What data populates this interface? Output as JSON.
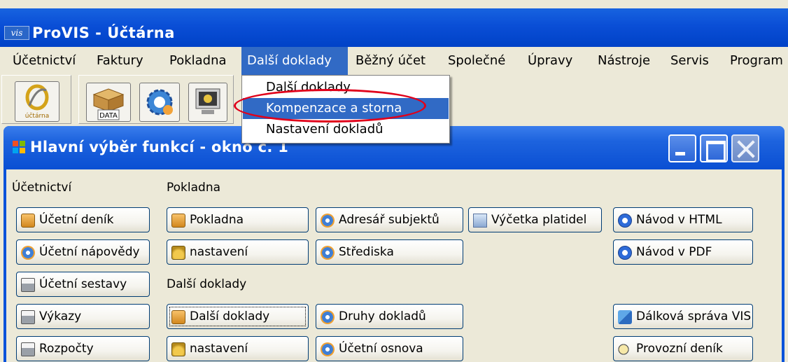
{
  "window": {
    "title": "ProVIS - Účtárna",
    "icon_text": "vis"
  },
  "menubar": {
    "items": [
      {
        "label": "Účetnictví",
        "active": false
      },
      {
        "label": "Faktury",
        "active": false
      },
      {
        "label": "Pokladna",
        "active": false
      },
      {
        "label": "Další doklady",
        "active": true
      },
      {
        "label": "Běžný účet",
        "active": false
      },
      {
        "label": "Společné",
        "active": false
      },
      {
        "label": "Úpravy",
        "active": false
      },
      {
        "label": "Nástroje",
        "active": false
      },
      {
        "label": "Servis",
        "active": false
      },
      {
        "label": "Program",
        "active": false
      }
    ]
  },
  "toolbar": {
    "data_label": "DATA",
    "logo_text": "účtárna"
  },
  "dropdown": {
    "items": [
      {
        "label": "Další doklady",
        "selected": false
      },
      {
        "label": "Kompenzace a storna",
        "selected": true
      },
      {
        "label": "Nastavení dokladů",
        "selected": false
      }
    ]
  },
  "inner_window": {
    "title": "Hlavní výběr funkcí - okno č. 1",
    "sections": {
      "ucetnictvi": "Účetnictví",
      "pokladna": "Pokladna",
      "dalsi_doklady": "Další doklady"
    },
    "buttons": {
      "ucetni_denik": "Účetní deník",
      "ucetni_napovedy": "Účetní nápovědy",
      "ucetni_sestavy": "Účetní sestavy",
      "vykazy": "Výkazy",
      "rozpocty": "Rozpočty",
      "pokladna": "Pokladna",
      "pokladna_nastaveni": "nastavení",
      "dalsi_doklady": "Další doklady",
      "dalsi_nastaveni": "nastavení",
      "adresar": "Adresář subjektů",
      "strediska": "Střediska",
      "druhy_dokladu": "Druhy dokladů",
      "ucetni_osnova": "Účetní osnova",
      "vycetka": "Výčetka platidel",
      "navod_html": "Návod v HTML",
      "navod_pdf": "Návod v PDF",
      "dalkova_sprava": "Dálková správa VIS",
      "provozni_denik": "Provozní deník"
    }
  }
}
